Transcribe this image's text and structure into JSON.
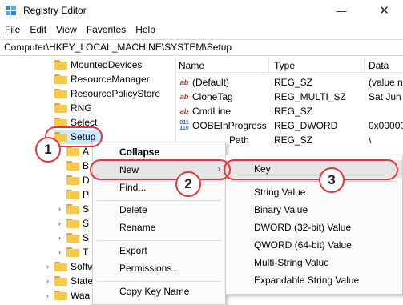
{
  "window": {
    "title": "Registry Editor",
    "minimize_glyph": "—",
    "close_glyph": "✕"
  },
  "menubar": {
    "items": [
      "File",
      "Edit",
      "View",
      "Favorites",
      "Help"
    ]
  },
  "address": {
    "path": "Computer\\HKEY_LOCAL_MACHINE\\SYSTEM\\Setup"
  },
  "tree": {
    "items": [
      {
        "label": "MountedDevices"
      },
      {
        "label": "ResourceManager"
      },
      {
        "label": "ResourcePolicyStore"
      },
      {
        "label": "RNG"
      },
      {
        "label": "Select"
      },
      {
        "label": "Setup"
      },
      {
        "label": "A"
      },
      {
        "label": "B"
      },
      {
        "label": "D"
      },
      {
        "label": "P"
      },
      {
        "label": "S"
      },
      {
        "label": "S"
      },
      {
        "label": "S"
      },
      {
        "label": "T"
      },
      {
        "label": "Softw"
      },
      {
        "label": "State"
      },
      {
        "label": "Waa"
      }
    ]
  },
  "list": {
    "columns": [
      "Name",
      "Type",
      "Data"
    ],
    "rows": [
      {
        "name": "(Default)",
        "type": "REG_SZ",
        "data": "(value n",
        "icon": "ab"
      },
      {
        "name": "CloneTag",
        "type": "REG_MULTI_SZ",
        "data": "Sat Jun (",
        "icon": "ab"
      },
      {
        "name": "CmdLine",
        "type": "REG_SZ",
        "data": "",
        "icon": "ab"
      },
      {
        "name": "OOBEInProgress",
        "type": "REG_DWORD",
        "data": "0x00000",
        "icon": "bin"
      },
      {
        "name": "Path",
        "type": "REG_SZ",
        "data": "\\",
        "icon": "ab"
      }
    ]
  },
  "context_menu": {
    "items": [
      "Collapse",
      "New",
      "Find...",
      "Delete",
      "Rename",
      "Export",
      "Permissions...",
      "Copy Key Name"
    ],
    "submenu_arrow": "›"
  },
  "new_submenu": {
    "items": [
      "Key",
      "String Value",
      "Binary Value",
      "DWORD (32-bit) Value",
      "QWORD (64-bit) Value",
      "Multi-String Value",
      "Expandable String Value"
    ]
  },
  "annotations": {
    "steps": [
      "1",
      "2",
      "3"
    ],
    "color": "#e0383e"
  },
  "colors": {
    "selection": "#cce8ff",
    "folder": "#f7c948",
    "menu_highlight": "#e5e5e5"
  }
}
